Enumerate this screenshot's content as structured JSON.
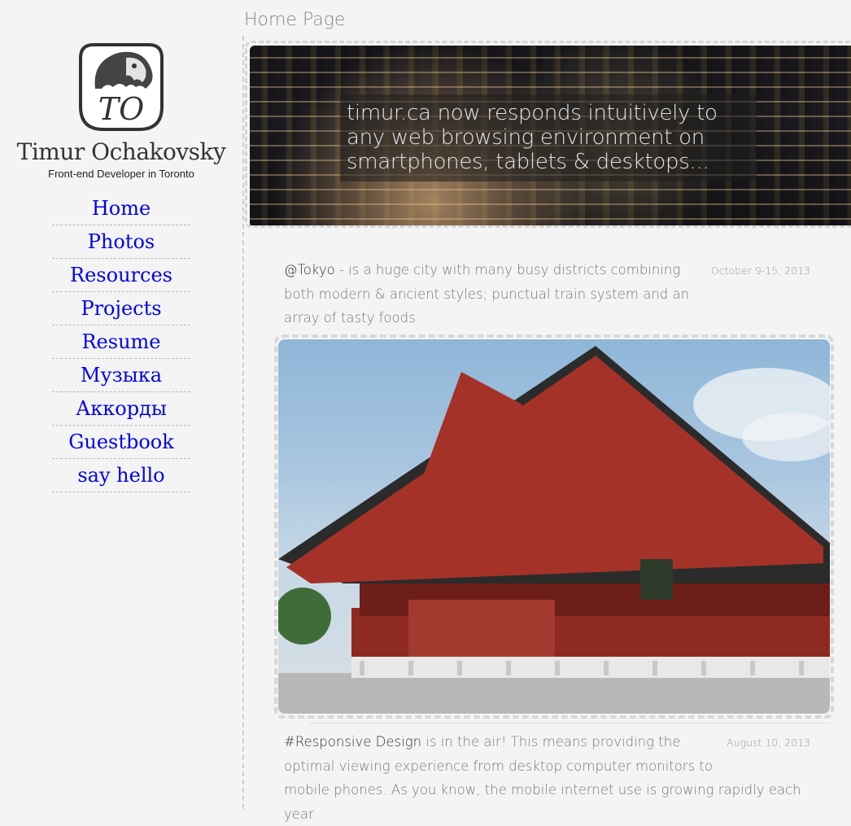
{
  "sidebar": {
    "logo_text": "TO",
    "name": "Timur Ochakovsky",
    "tagline": "Front-end Developer in Toronto",
    "nav": [
      {
        "label": "Home"
      },
      {
        "label": "Photos"
      },
      {
        "label": "Resources"
      },
      {
        "label": "Projects"
      },
      {
        "label": "Resume"
      },
      {
        "label": "Музыка"
      },
      {
        "label": "Аккорды"
      },
      {
        "label": "Guestbook"
      },
      {
        "label": "say hello"
      }
    ]
  },
  "main": {
    "page_title": "Home Page",
    "hero_caption": "timur.ca now responds intuitively to any web browsing environment on smartphones, tablets & desktops...",
    "posts": [
      {
        "tag": "@Tokyo",
        "text": " - is a huge city with many busy districts combining both modern & ancient styles; punctual train system and an array of tasty foods",
        "date": "October 9-15, 2013"
      },
      {
        "tag": "#Responsive Design",
        "text": " is in the air! This means providing the optimal viewing experience from desktop computer monitors to mobile phones. As you know, the mobile internet use is growing rapidly each year",
        "date": "August 10, 2013"
      }
    ]
  },
  "colors": {
    "background": "#f4f4f4",
    "link": "#0000ee",
    "text_muted": "#777777"
  }
}
